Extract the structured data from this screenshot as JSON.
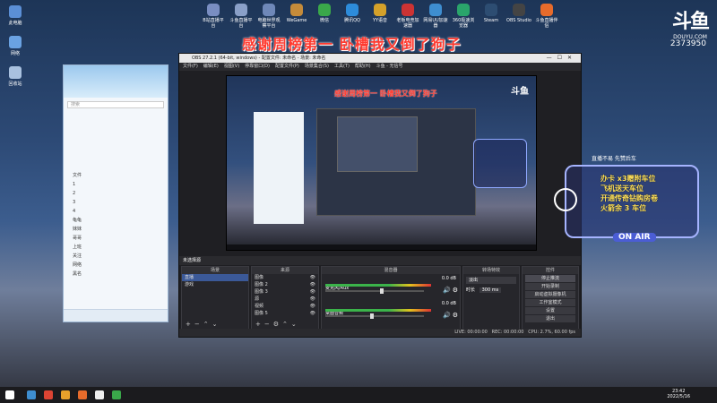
{
  "desktop": {
    "icons": [
      {
        "label": "此电脑"
      },
      {
        "label": "网络"
      },
      {
        "label": "回收站"
      }
    ],
    "top_icons": [
      {
        "label": "B站直播平台",
        "color": "#7a8ec2"
      },
      {
        "label": "斗鱼直播平台",
        "color": "#8aa0c8"
      },
      {
        "label": "电脑世界观察平台",
        "color": "#6f88b8"
      },
      {
        "label": "WeGame",
        "color": "#c58b3a"
      },
      {
        "label": "微信",
        "color": "#3aa84a"
      },
      {
        "label": "腾讯QQ",
        "color": "#2d8cdb"
      },
      {
        "label": "YY语音",
        "color": "#d4a12a"
      },
      {
        "label": "老板电竞加速器",
        "color": "#c33"
      },
      {
        "label": "网易UU加速器",
        "color": "#3e8ed0"
      },
      {
        "label": "360极速浏览器",
        "color": "#2aa56b"
      },
      {
        "label": "Steam",
        "color": "#2d4d72"
      },
      {
        "label": "OBS Studio",
        "color": "#444"
      },
      {
        "label": "斗鱼直播伴侣",
        "color": "#e76b2b"
      }
    ],
    "banner": "感谢周榜第一 卧槽我又倒了狗子",
    "logo": "斗鱼",
    "logo_sub": "DOUYU.COM",
    "room_number": "2373950"
  },
  "qq_panel": {
    "search_placeholder": "搜索",
    "contacts": [
      "文件",
      "1",
      "2",
      "3",
      "4",
      "龟龟",
      "妹妹",
      "哥哥",
      "上班",
      "关注",
      "网络",
      "黑名"
    ]
  },
  "obs": {
    "title": "OBS 27.2.1 (64-bit, windows) - 配置文件: 未命名 - 场景: 未命名",
    "menu": [
      "文件(F)",
      "编辑(E)",
      "视图(V)",
      "停靠窗口(D)",
      "配置文件(P)",
      "场景集合(S)",
      "工具(T)",
      "帮助(H)",
      "斗鱼 - 无信号"
    ],
    "preview_banner": "感谢周榜第一 卧槽我又倒了狗子",
    "preview_logo": "斗鱼",
    "scene_bar_label": "未选择源",
    "docks": {
      "scenes": {
        "title": "场景",
        "items": [
          "直播",
          "游戏"
        ]
      },
      "sources": {
        "title": "来源",
        "items": [
          "图像",
          "图像 2",
          "图像 3",
          "源",
          "视频",
          "图像 5"
        ]
      },
      "mixer": {
        "title": "混音器",
        "tracks": [
          {
            "name": "麦克风/Aux",
            "level": "0.0 dB",
            "fill": 0.55
          },
          {
            "name": "桌面音频",
            "level": "0.0 dB",
            "fill": 0.45
          }
        ]
      },
      "transitions": {
        "title": "转场特效",
        "type": "淡出",
        "duration_label": "时长",
        "duration": "300 ms"
      },
      "controls": {
        "title": "控件",
        "buttons": [
          "停止推流",
          "开始录制",
          "启动虚拟摄像机",
          "工作室模式",
          "设置",
          "退出"
        ]
      }
    },
    "status": {
      "live": "LIVE: 00:00:00",
      "rec": "REC: 00:00:00",
      "cpu": "CPU: 2.7%, 60.00 fps"
    }
  },
  "promo": {
    "header": "直播不易 先赞后车",
    "lines": [
      "办卡 x3赠附车位",
      "飞机送天车位",
      "开通传奇钻购房卷",
      "火箭余 3 车位"
    ],
    "badge": "ON AIR"
  },
  "taskbar": {
    "time": "23:42",
    "date": "2022/5/16",
    "app_colors": [
      "#3e8ed0",
      "#d43",
      "#e7a12b",
      "#e76b2b",
      "#eee",
      "#3aa84a"
    ]
  }
}
